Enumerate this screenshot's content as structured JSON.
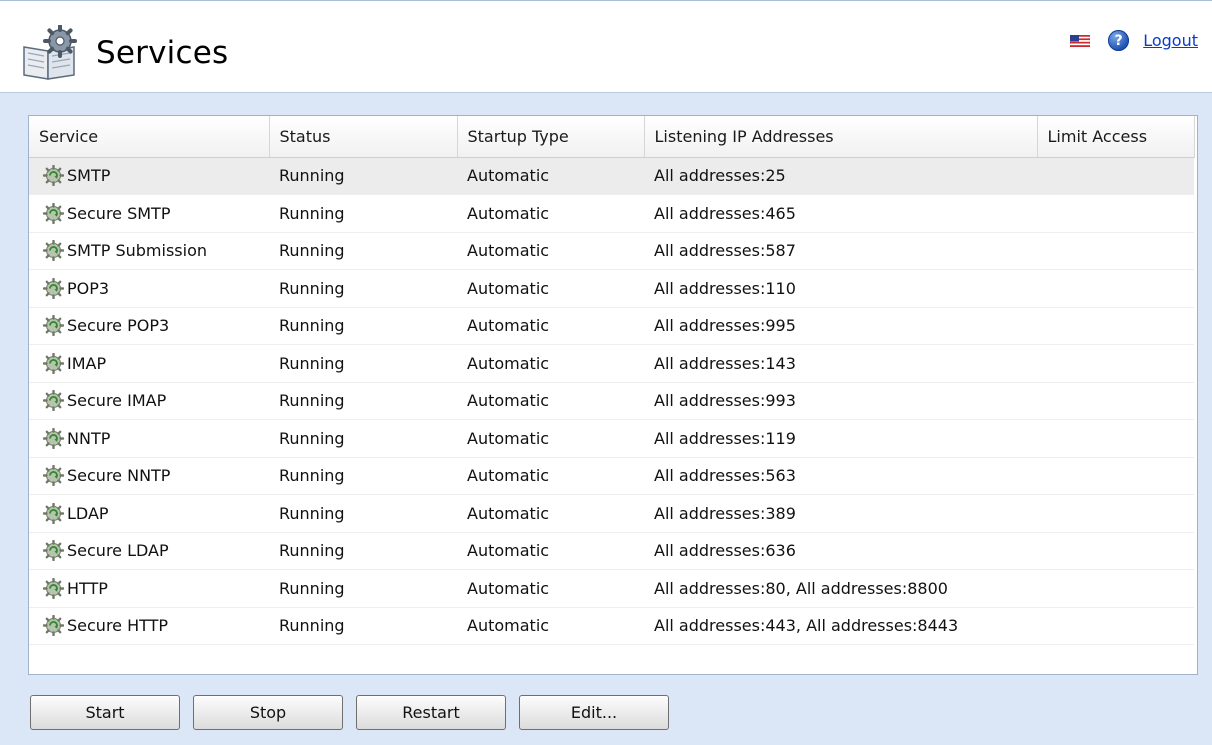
{
  "header": {
    "title": "Services",
    "logout_label": "Logout"
  },
  "icons": {
    "app": "services-book-gear-icon",
    "flag": "us-flag-icon",
    "help": "help-icon",
    "row": "service-gear-icon"
  },
  "table": {
    "columns": [
      "Service",
      "Status",
      "Startup Type",
      "Listening IP Addresses",
      "Limit Access"
    ],
    "selected_row": 0,
    "rows": [
      {
        "service": "SMTP",
        "status": "Running",
        "startup": "Automatic",
        "addresses": "All addresses:25",
        "limit": ""
      },
      {
        "service": "Secure SMTP",
        "status": "Running",
        "startup": "Automatic",
        "addresses": "All addresses:465",
        "limit": ""
      },
      {
        "service": "SMTP Submission",
        "status": "Running",
        "startup": "Automatic",
        "addresses": "All addresses:587",
        "limit": ""
      },
      {
        "service": "POP3",
        "status": "Running",
        "startup": "Automatic",
        "addresses": "All addresses:110",
        "limit": ""
      },
      {
        "service": "Secure POP3",
        "status": "Running",
        "startup": "Automatic",
        "addresses": "All addresses:995",
        "limit": ""
      },
      {
        "service": "IMAP",
        "status": "Running",
        "startup": "Automatic",
        "addresses": "All addresses:143",
        "limit": ""
      },
      {
        "service": "Secure IMAP",
        "status": "Running",
        "startup": "Automatic",
        "addresses": "All addresses:993",
        "limit": ""
      },
      {
        "service": "NNTP",
        "status": "Running",
        "startup": "Automatic",
        "addresses": "All addresses:119",
        "limit": ""
      },
      {
        "service": "Secure NNTP",
        "status": "Running",
        "startup": "Automatic",
        "addresses": "All addresses:563",
        "limit": ""
      },
      {
        "service": "LDAP",
        "status": "Running",
        "startup": "Automatic",
        "addresses": "All addresses:389",
        "limit": ""
      },
      {
        "service": "Secure LDAP",
        "status": "Running",
        "startup": "Automatic",
        "addresses": "All addresses:636",
        "limit": ""
      },
      {
        "service": "HTTP",
        "status": "Running",
        "startup": "Automatic",
        "addresses": "All addresses:80, All addresses:8800",
        "limit": ""
      },
      {
        "service": "Secure HTTP",
        "status": "Running",
        "startup": "Automatic",
        "addresses": "All addresses:443, All addresses:8443",
        "limit": ""
      }
    ]
  },
  "buttons": {
    "start": "Start",
    "stop": "Stop",
    "restart": "Restart",
    "edit": "Edit..."
  }
}
